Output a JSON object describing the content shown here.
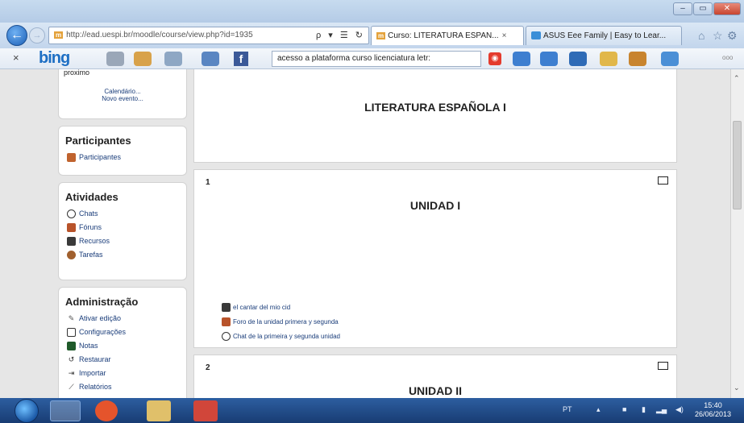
{
  "browser": {
    "address": {
      "url": "http://ead.uespi.br/moodle/course/view.php?id=1935",
      "favicon_text": "m",
      "controls": "ρ ▾ ☰ ↻"
    },
    "tabs": [
      {
        "label": "Curso: LITERATURA ESPAN...",
        "favicon_text": "m",
        "close": "×"
      },
      {
        "label": "ASUS Eee Family | Easy to Lear...",
        "close": ""
      }
    ],
    "right_icons": [
      "⌂",
      "☆",
      "⚙"
    ]
  },
  "bingbar": {
    "close": "×",
    "logo": "bing",
    "facebook": "f",
    "search_value": "acesso a plataforma curso licenciatura letr:",
    "more": "ooo"
  },
  "sidebar": {
    "top_partial": "proximo",
    "calendar": "Calendário...",
    "new_event": "Novo evento...",
    "participants": {
      "title": "Participantes",
      "items": [
        "Participantes"
      ]
    },
    "activities": {
      "title": "Atividades",
      "items": [
        "Chats",
        "Fóruns",
        "Recursos",
        "Tarefas"
      ]
    },
    "admin": {
      "title": "Administração",
      "items": [
        "Ativar edição",
        "Configurações",
        "Notas",
        "Restaurar",
        "Importar",
        "Relatórios"
      ]
    }
  },
  "main": {
    "course_title": "LITERATURA ESPAÑOLA I",
    "sections": [
      {
        "number": "1",
        "title": "UNIDAD I",
        "resources": [
          "el cantar del mio cid",
          "Foro de la unidad primera y segunda",
          "Chat de la primeira y segunda unidad"
        ]
      },
      {
        "number": "2",
        "title": "UNIDAD II",
        "resources": []
      }
    ]
  },
  "taskbar": {
    "tray_lang": "PT",
    "clock_time": "15:40",
    "clock_date": "26/06/2013"
  },
  "colors": {
    "link": "#1a3d7a",
    "taskbar": "#1f4a88",
    "background": "#e6e6e6"
  }
}
